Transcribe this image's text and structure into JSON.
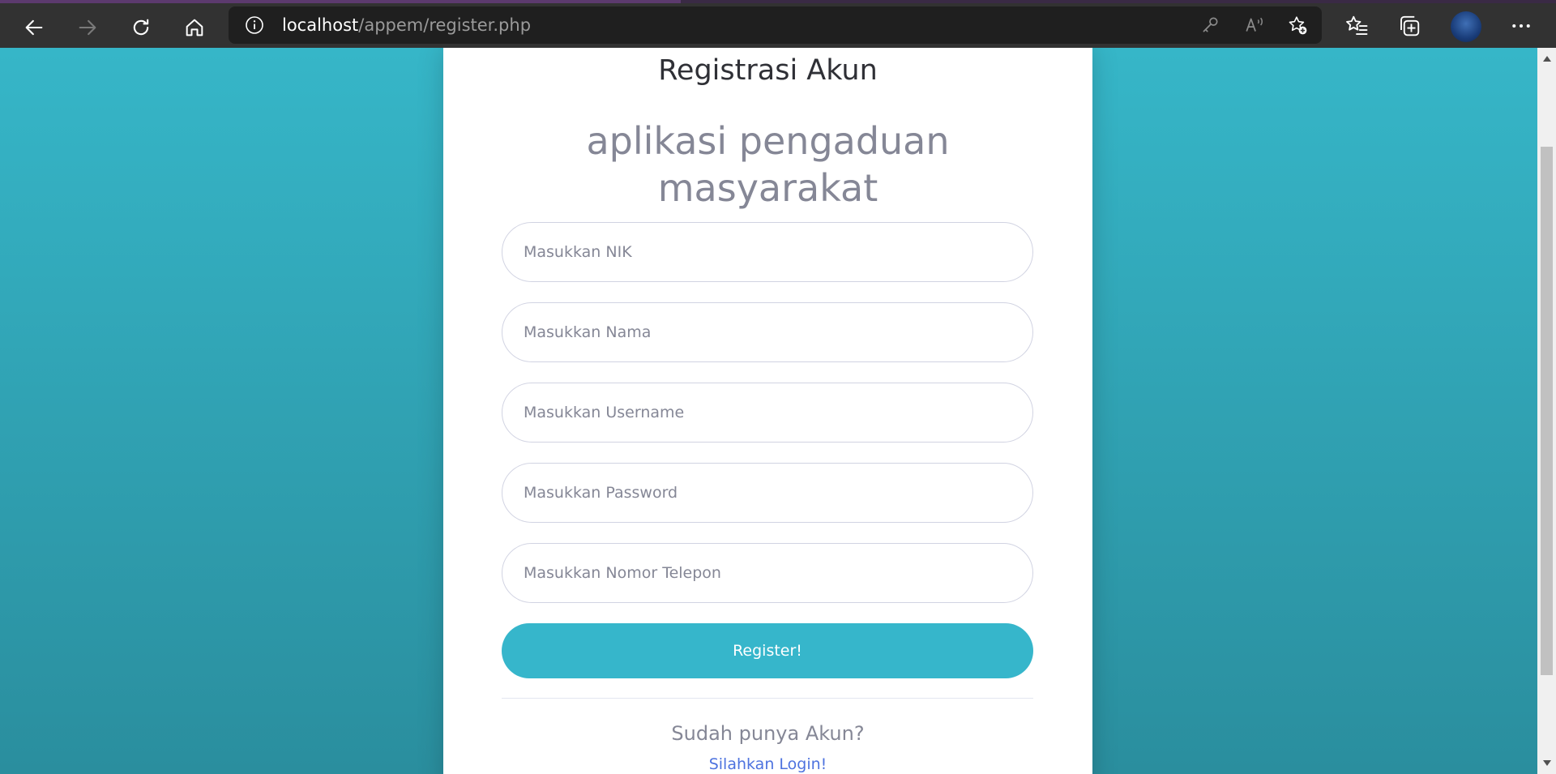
{
  "browser": {
    "url_host": "localhost",
    "url_path": "/appem/register.php",
    "icons": {
      "back": "back-arrow-icon",
      "forward": "forward-arrow-icon",
      "refresh": "refresh-icon",
      "home": "home-icon",
      "info": "info-icon",
      "key": "key-icon",
      "read_aloud": "read-aloud-icon",
      "add_favorite": "add-favorite-icon",
      "favorites": "favorites-icon",
      "collections": "collections-icon",
      "profile": "profile-avatar",
      "more": "more-icon"
    }
  },
  "card": {
    "title": "Registrasi Akun",
    "subtitle": "aplikasi pengaduan masyarakat",
    "fields": {
      "nik_placeholder": "Masukkan NIK",
      "nama_placeholder": "Masukkan Nama",
      "username_placeholder": "Masukkan Username",
      "password_placeholder": "Masukkan Password",
      "telepon_placeholder": "Masukkan Nomor Telepon"
    },
    "register_label": "Register!",
    "question": "Sudah punya Akun?",
    "login_label": "Silahkan Login!"
  },
  "colors": {
    "accent": "#36b6cb",
    "link": "#4e73df",
    "background_top": "#36b6c8",
    "background_bottom": "#2a8e9e"
  }
}
